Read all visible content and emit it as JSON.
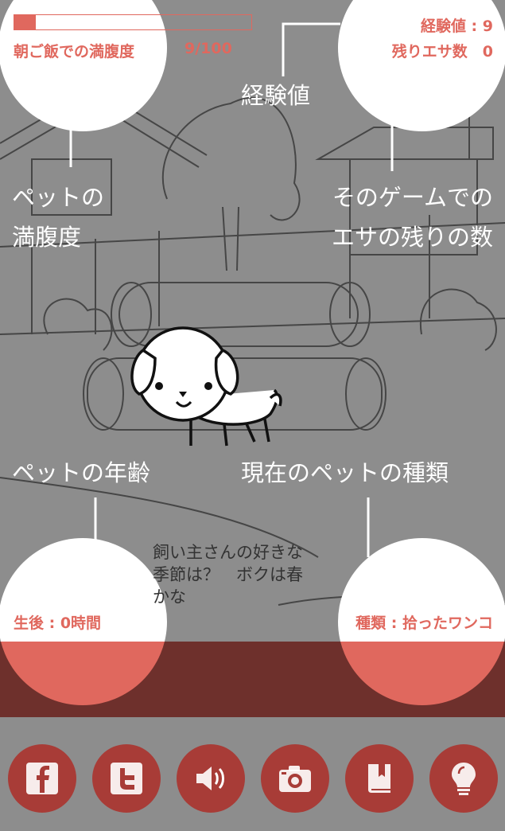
{
  "status": {
    "satiety_label": "朝ご飯での満腹度",
    "satiety_value": "9/100",
    "satiety_fraction": 0.09,
    "exp_label": "経験値 : 9",
    "food_remaining_label": "残りエサ数　0"
  },
  "annotations": {
    "exp": "経験値",
    "satiety_line1": "ペットの",
    "satiety_line2": "満腹度",
    "food_line1": "そのゲームでの",
    "food_line2": "エサの残りの数",
    "age": "ペットの年齢",
    "species": "現在のペットの種類"
  },
  "pet": {
    "age_label": "生後 : 0時間",
    "species_label": "種類 : 拾ったワンコ",
    "speech": "飼い主さんの好きな季節は？　ボクは春かな"
  },
  "toolbar": {
    "buttons": [
      "facebook-icon",
      "twitter-icon",
      "sound-icon",
      "camera-icon",
      "book-icon",
      "lightbulb-icon"
    ]
  },
  "colors": {
    "accent": "#e0685e",
    "button": "#a83c37",
    "band": "#6e302c",
    "overlay": "#8d8d8d"
  }
}
